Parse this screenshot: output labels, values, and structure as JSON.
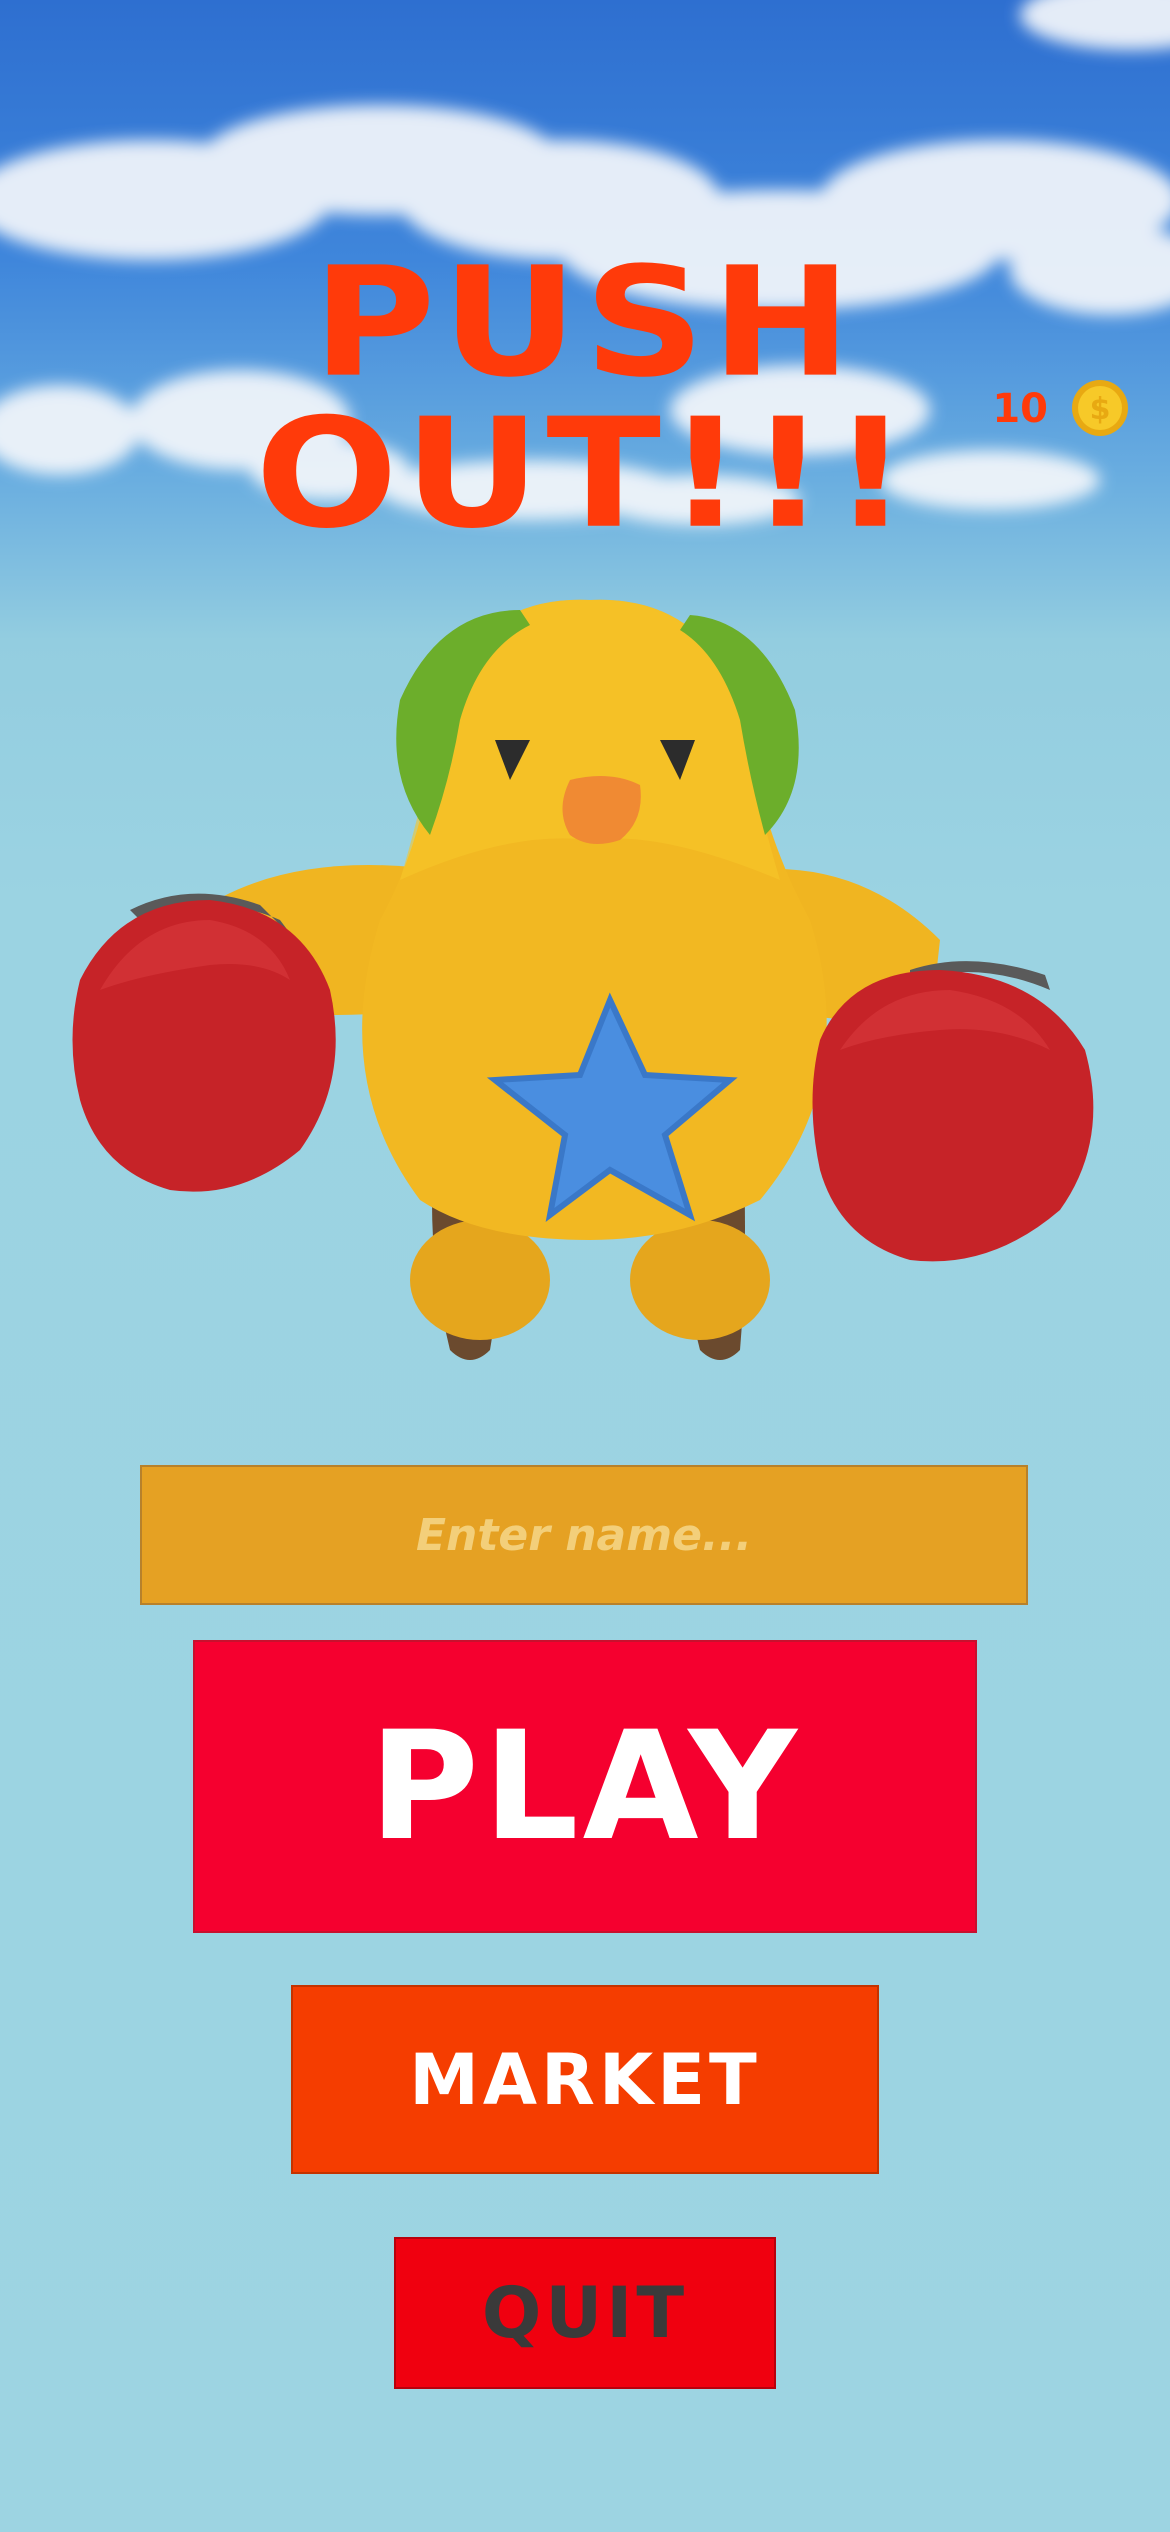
{
  "game": {
    "title": "PUSH OUT!!!",
    "coins": "10",
    "coin_icon": "dollar-coin-icon"
  },
  "character": {
    "description_icon": "yellow-bird-boxer-character"
  },
  "menu": {
    "name_placeholder": "Enter name...",
    "play_label": "PLAY",
    "market_label": "MARKET",
    "quit_label": "QUIT"
  },
  "colors": {
    "title": "#ff3a0a",
    "input_bg": "#e5a123",
    "play_bg": "#f5002f",
    "market_bg": "#f53d00",
    "quit_bg": "#f0000f",
    "background": "#9dd4e2"
  }
}
